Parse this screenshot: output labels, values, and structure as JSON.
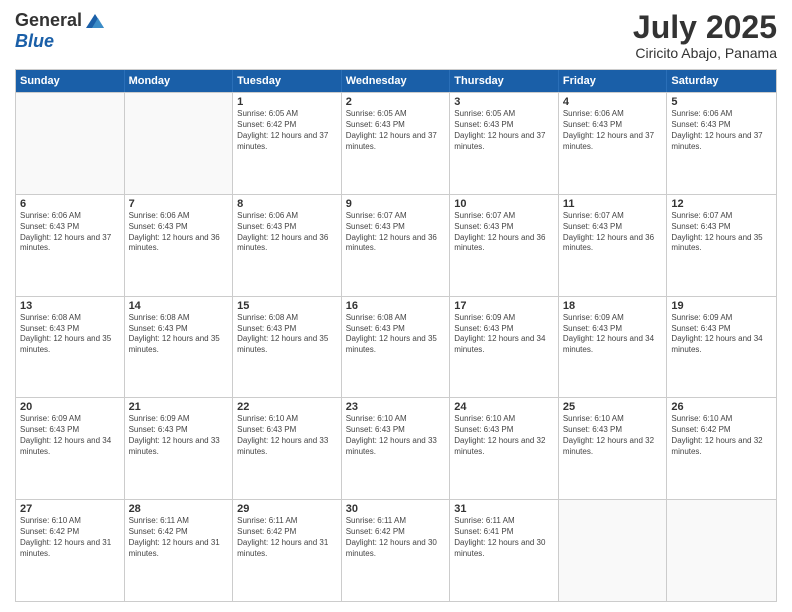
{
  "header": {
    "logo_general": "General",
    "logo_blue": "Blue",
    "month": "July 2025",
    "location": "Ciricito Abajo, Panama"
  },
  "days_of_week": [
    "Sunday",
    "Monday",
    "Tuesday",
    "Wednesday",
    "Thursday",
    "Friday",
    "Saturday"
  ],
  "weeks": [
    [
      {
        "day": "",
        "empty": true
      },
      {
        "day": "",
        "empty": true
      },
      {
        "day": "1",
        "sunrise": "Sunrise: 6:05 AM",
        "sunset": "Sunset: 6:42 PM",
        "daylight": "Daylight: 12 hours and 37 minutes."
      },
      {
        "day": "2",
        "sunrise": "Sunrise: 6:05 AM",
        "sunset": "Sunset: 6:43 PM",
        "daylight": "Daylight: 12 hours and 37 minutes."
      },
      {
        "day": "3",
        "sunrise": "Sunrise: 6:05 AM",
        "sunset": "Sunset: 6:43 PM",
        "daylight": "Daylight: 12 hours and 37 minutes."
      },
      {
        "day": "4",
        "sunrise": "Sunrise: 6:06 AM",
        "sunset": "Sunset: 6:43 PM",
        "daylight": "Daylight: 12 hours and 37 minutes."
      },
      {
        "day": "5",
        "sunrise": "Sunrise: 6:06 AM",
        "sunset": "Sunset: 6:43 PM",
        "daylight": "Daylight: 12 hours and 37 minutes."
      }
    ],
    [
      {
        "day": "6",
        "sunrise": "Sunrise: 6:06 AM",
        "sunset": "Sunset: 6:43 PM",
        "daylight": "Daylight: 12 hours and 37 minutes."
      },
      {
        "day": "7",
        "sunrise": "Sunrise: 6:06 AM",
        "sunset": "Sunset: 6:43 PM",
        "daylight": "Daylight: 12 hours and 36 minutes."
      },
      {
        "day": "8",
        "sunrise": "Sunrise: 6:06 AM",
        "sunset": "Sunset: 6:43 PM",
        "daylight": "Daylight: 12 hours and 36 minutes."
      },
      {
        "day": "9",
        "sunrise": "Sunrise: 6:07 AM",
        "sunset": "Sunset: 6:43 PM",
        "daylight": "Daylight: 12 hours and 36 minutes."
      },
      {
        "day": "10",
        "sunrise": "Sunrise: 6:07 AM",
        "sunset": "Sunset: 6:43 PM",
        "daylight": "Daylight: 12 hours and 36 minutes."
      },
      {
        "day": "11",
        "sunrise": "Sunrise: 6:07 AM",
        "sunset": "Sunset: 6:43 PM",
        "daylight": "Daylight: 12 hours and 36 minutes."
      },
      {
        "day": "12",
        "sunrise": "Sunrise: 6:07 AM",
        "sunset": "Sunset: 6:43 PM",
        "daylight": "Daylight: 12 hours and 35 minutes."
      }
    ],
    [
      {
        "day": "13",
        "sunrise": "Sunrise: 6:08 AM",
        "sunset": "Sunset: 6:43 PM",
        "daylight": "Daylight: 12 hours and 35 minutes."
      },
      {
        "day": "14",
        "sunrise": "Sunrise: 6:08 AM",
        "sunset": "Sunset: 6:43 PM",
        "daylight": "Daylight: 12 hours and 35 minutes."
      },
      {
        "day": "15",
        "sunrise": "Sunrise: 6:08 AM",
        "sunset": "Sunset: 6:43 PM",
        "daylight": "Daylight: 12 hours and 35 minutes."
      },
      {
        "day": "16",
        "sunrise": "Sunrise: 6:08 AM",
        "sunset": "Sunset: 6:43 PM",
        "daylight": "Daylight: 12 hours and 35 minutes."
      },
      {
        "day": "17",
        "sunrise": "Sunrise: 6:09 AM",
        "sunset": "Sunset: 6:43 PM",
        "daylight": "Daylight: 12 hours and 34 minutes."
      },
      {
        "day": "18",
        "sunrise": "Sunrise: 6:09 AM",
        "sunset": "Sunset: 6:43 PM",
        "daylight": "Daylight: 12 hours and 34 minutes."
      },
      {
        "day": "19",
        "sunrise": "Sunrise: 6:09 AM",
        "sunset": "Sunset: 6:43 PM",
        "daylight": "Daylight: 12 hours and 34 minutes."
      }
    ],
    [
      {
        "day": "20",
        "sunrise": "Sunrise: 6:09 AM",
        "sunset": "Sunset: 6:43 PM",
        "daylight": "Daylight: 12 hours and 34 minutes."
      },
      {
        "day": "21",
        "sunrise": "Sunrise: 6:09 AM",
        "sunset": "Sunset: 6:43 PM",
        "daylight": "Daylight: 12 hours and 33 minutes."
      },
      {
        "day": "22",
        "sunrise": "Sunrise: 6:10 AM",
        "sunset": "Sunset: 6:43 PM",
        "daylight": "Daylight: 12 hours and 33 minutes."
      },
      {
        "day": "23",
        "sunrise": "Sunrise: 6:10 AM",
        "sunset": "Sunset: 6:43 PM",
        "daylight": "Daylight: 12 hours and 33 minutes."
      },
      {
        "day": "24",
        "sunrise": "Sunrise: 6:10 AM",
        "sunset": "Sunset: 6:43 PM",
        "daylight": "Daylight: 12 hours and 32 minutes."
      },
      {
        "day": "25",
        "sunrise": "Sunrise: 6:10 AM",
        "sunset": "Sunset: 6:43 PM",
        "daylight": "Daylight: 12 hours and 32 minutes."
      },
      {
        "day": "26",
        "sunrise": "Sunrise: 6:10 AM",
        "sunset": "Sunset: 6:42 PM",
        "daylight": "Daylight: 12 hours and 32 minutes."
      }
    ],
    [
      {
        "day": "27",
        "sunrise": "Sunrise: 6:10 AM",
        "sunset": "Sunset: 6:42 PM",
        "daylight": "Daylight: 12 hours and 31 minutes."
      },
      {
        "day": "28",
        "sunrise": "Sunrise: 6:11 AM",
        "sunset": "Sunset: 6:42 PM",
        "daylight": "Daylight: 12 hours and 31 minutes."
      },
      {
        "day": "29",
        "sunrise": "Sunrise: 6:11 AM",
        "sunset": "Sunset: 6:42 PM",
        "daylight": "Daylight: 12 hours and 31 minutes."
      },
      {
        "day": "30",
        "sunrise": "Sunrise: 6:11 AM",
        "sunset": "Sunset: 6:42 PM",
        "daylight": "Daylight: 12 hours and 30 minutes."
      },
      {
        "day": "31",
        "sunrise": "Sunrise: 6:11 AM",
        "sunset": "Sunset: 6:41 PM",
        "daylight": "Daylight: 12 hours and 30 minutes."
      },
      {
        "day": "",
        "empty": true
      },
      {
        "day": "",
        "empty": true
      }
    ]
  ]
}
